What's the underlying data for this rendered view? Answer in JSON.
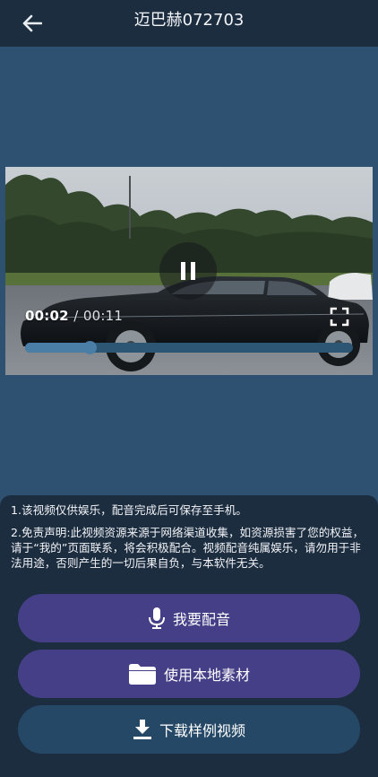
{
  "header": {
    "title": "迈巴赫072703",
    "back_icon": "arrow-left-icon"
  },
  "player": {
    "current_time": "00:02",
    "separator": "/",
    "duration": "00:11",
    "progress_fraction": 0.2,
    "state": "playing",
    "play_toggle_icon": "pause-icon",
    "fullscreen_icon": "fullscreen-icon"
  },
  "notice": {
    "line1": "1.该视频仅供娱乐，配音完成后可保存至手机。",
    "line2": "2.免责声明:此视频资源来源于网络渠道收集，如资源损害了您的权益，请于“我的”页面联系，将会积极配合。视频配音纯属娱乐，请勿用于非法用途，否则产生的一切后果自负，与本软件无关。"
  },
  "actions": {
    "record_label": "我要配音",
    "record_icon": "microphone-icon",
    "local_label": "使用本地素材",
    "local_icon": "folder-icon",
    "download_label": "下载样例视频",
    "download_icon": "download-icon"
  },
  "colors": {
    "page_background": "#2e5172",
    "header_background": "#1d2d40",
    "primary_button": "#443f86",
    "secondary_button": "#244866",
    "progress": "#4a7ea7"
  }
}
